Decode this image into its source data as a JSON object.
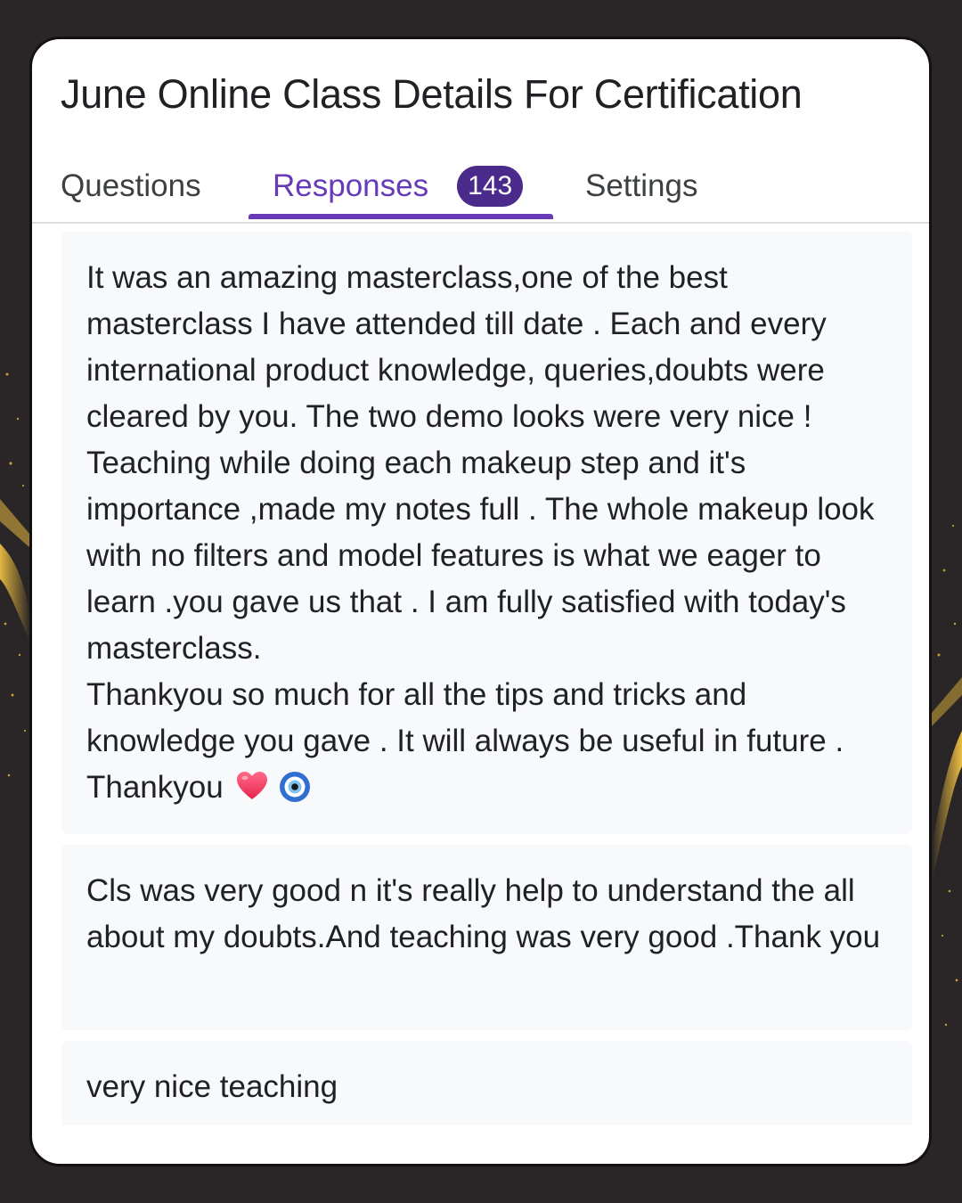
{
  "form": {
    "title": "June Online Class Details For Certification"
  },
  "tabs": {
    "questions": "Questions",
    "responses": "Responses",
    "responses_count": "143",
    "settings": "Settings"
  },
  "responses": [
    {
      "text": "It was an amazing masterclass,one of the best masterclass I have attended till date . Each and every international product knowledge, queries,doubts were cleared by you. The two demo looks were very nice ! Teaching while doing each makeup step and it's importance ,made my notes full . The whole makeup look with no filters and model features is what we eager to learn .you gave us that . I am fully satisfied with today's masterclass.\nThankyou so much for all the tips and tricks and knowledge you gave . It will always be useful in future . Thankyou",
      "emojis": [
        "heart-icon",
        "nazar-eye-icon"
      ]
    },
    {
      "text": "Cls was very good n it's really help to understand the all about my doubts.And teaching was very good .Thank you"
    },
    {
      "text": "very nice teaching"
    }
  ],
  "colors": {
    "accent": "#673ab7",
    "badge": "#4a2a8a",
    "card_background": "#f8f9fa",
    "page_background": "#2a2526",
    "text": "#202124"
  }
}
